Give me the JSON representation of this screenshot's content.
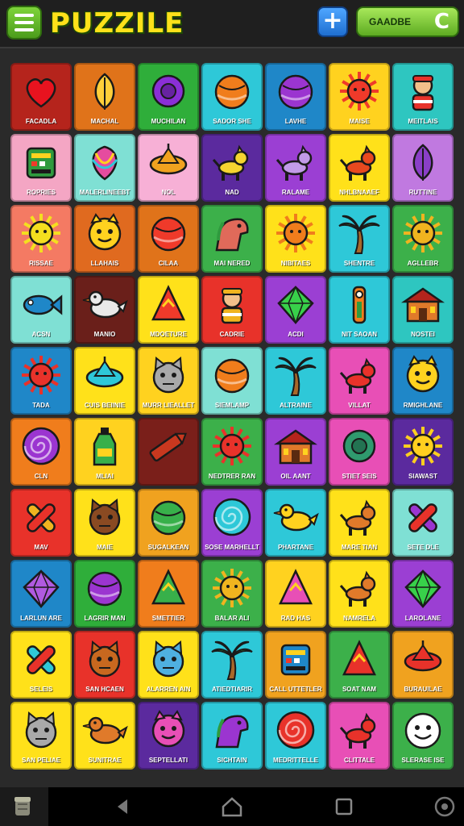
{
  "header": {
    "title": "PUZZILE",
    "game_label": "GAADBE",
    "add_symbol": "+",
    "game_icon": "C"
  },
  "colors": {
    "accent_green": "#5eac22",
    "title_yellow": "#ffe11a",
    "accent_blue": "#1f6fd1"
  },
  "tiles": [
    {
      "bg": "#b5241c",
      "icon": "heart",
      "c": "#e8131f",
      "caption": "FACADLA"
    },
    {
      "bg": "#e0731a",
      "icon": "leaf",
      "c": "#ffcf3a",
      "caption": "MACHAL"
    },
    {
      "bg": "#2fae3a",
      "icon": "ring",
      "c": "#8a2fd6",
      "caption": "MUCHILAN"
    },
    {
      "bg": "#2ec8d8",
      "icon": "ball",
      "c": "#f07d1c",
      "caption": "SADOR SHE"
    },
    {
      "bg": "#1f87c8",
      "icon": "ball",
      "c": "#9b35d0",
      "caption": "LAVHE"
    },
    {
      "bg": "#ffd21f",
      "icon": "sun",
      "c": "#ef3a2a",
      "caption": "MAISE"
    },
    {
      "bg": "#2ec6c0",
      "icon": "person",
      "c": "#e8322a",
      "caption": "MEITLAIS"
    },
    {
      "bg": "#f4a6c4",
      "icon": "square",
      "c": "#2f9a3e",
      "caption": "ROPRIES"
    },
    {
      "bg": "#7fe0d4",
      "icon": "balloon",
      "c": "#e54c9f",
      "caption": "MALERLINEEBT"
    },
    {
      "bg": "#f7b0d6",
      "icon": "spinner",
      "c": "#f0a21f",
      "caption": "NOL"
    },
    {
      "bg": "#5b2a9e",
      "icon": "dog",
      "c": "#f5d530",
      "caption": "NAD"
    },
    {
      "bg": "#9b3fd3",
      "icon": "dog",
      "c": "#c29be8",
      "caption": "RALAME"
    },
    {
      "bg": "#ffe11a",
      "icon": "dog",
      "c": "#e8491f",
      "caption": "NHLBNAAEF"
    },
    {
      "bg": "#c079e0",
      "icon": "leaf",
      "c": "#8a3fc8",
      "caption": "RUTTINE"
    },
    {
      "bg": "#f47a63",
      "icon": "sun",
      "c": "#f4df1f",
      "caption": "RISSAE"
    },
    {
      "bg": "#e06a1f",
      "icon": "face",
      "c": "#ffd21f",
      "caption": "LLAHAIS"
    },
    {
      "bg": "#e0731a",
      "icon": "ball",
      "c": "#ef3a2a",
      "caption": "CILAA"
    },
    {
      "bg": "#3cb04a",
      "icon": "horse",
      "c": "#e06a5a",
      "caption": "MAI NERED"
    },
    {
      "bg": "#ffe11a",
      "icon": "sun",
      "c": "#f07d1c",
      "caption": "NIBITAES"
    },
    {
      "bg": "#2ec8d8",
      "icon": "palm",
      "c": "#2f9a3e",
      "caption": "SHENTRE"
    },
    {
      "bg": "#3cb04a",
      "icon": "sun",
      "c": "#f0b41f",
      "caption": "AGLLEBR"
    },
    {
      "bg": "#7fe0d4",
      "icon": "fish",
      "c": "#1f87c8",
      "caption": "ACSN"
    },
    {
      "bg": "#6a1f1a",
      "icon": "bird",
      "c": "#e9e9e9",
      "caption": "MANIO"
    },
    {
      "bg": "#ffe11a",
      "icon": "cone",
      "c": "#ef3a2a",
      "caption": "MDOETURE"
    },
    {
      "bg": "#e8322a",
      "icon": "person",
      "c": "#f0b41f",
      "caption": "CADRIE"
    },
    {
      "bg": "#9b3fd3",
      "icon": "gem",
      "c": "#38d04a",
      "caption": "ACDI"
    },
    {
      "bg": "#2ec8d8",
      "icon": "key",
      "c": "#f07d1c",
      "caption": "NIT SAOAN"
    },
    {
      "bg": "#2ec6c0",
      "icon": "house",
      "c": "#b5241c",
      "caption": "NOSTEI"
    },
    {
      "bg": "#1f87c8",
      "icon": "sun",
      "c": "#e8322a",
      "caption": "TADA"
    },
    {
      "bg": "#ffe11a",
      "icon": "spinner",
      "c": "#2ec8d8",
      "caption": "CUIS BEIINIE"
    },
    {
      "bg": "#ffd21f",
      "icon": "cat",
      "c": "#a9a9a9",
      "caption": "MURR LIEALLET"
    },
    {
      "bg": "#7fe0d4",
      "icon": "ball",
      "c": "#f07d1c",
      "caption": "SIEMLAMP"
    },
    {
      "bg": "#2ec8d8",
      "icon": "palm",
      "c": "#2f9a3e",
      "caption": "ALTRAINE"
    },
    {
      "bg": "#e84fb6",
      "icon": "dog",
      "c": "#e8322a",
      "caption": "VILLAT"
    },
    {
      "bg": "#1f87c8",
      "icon": "face",
      "c": "#ffd21f",
      "caption": "RMIGHLANE"
    },
    {
      "bg": "#f07d1c",
      "icon": "spiral",
      "c": "#9b35d0",
      "caption": "CLN"
    },
    {
      "bg": "#ffd21f",
      "icon": "bottle",
      "c": "#38b04a",
      "caption": "MLIAI"
    },
    {
      "bg": "#7a1f1a",
      "icon": "crayon",
      "c": "#c8381f",
      "caption": ""
    },
    {
      "bg": "#3cb04a",
      "icon": "sun",
      "c": "#e8322a",
      "caption": "NEDTRER RAN"
    },
    {
      "bg": "#9b3fd3",
      "icon": "house",
      "c": "#b5241c",
      "caption": "OIL AANT"
    },
    {
      "bg": "#e84fb6",
      "icon": "ring",
      "c": "#2f9a6e",
      "caption": "STIET SEIS"
    },
    {
      "bg": "#5b2a9e",
      "icon": "sun",
      "c": "#ffcf1f",
      "caption": "SIAWAST"
    },
    {
      "bg": "#e8322a",
      "icon": "cross",
      "c": "#f0b41f",
      "caption": "MAV"
    },
    {
      "bg": "#ffe11a",
      "icon": "cat",
      "c": "#8a4a22",
      "caption": "MAIE"
    },
    {
      "bg": "#f0a21f",
      "icon": "ball",
      "c": "#38b04a",
      "caption": "SUGALKEAN"
    },
    {
      "bg": "#9b3fd3",
      "icon": "spiral",
      "c": "#2ec8d8",
      "caption": "SOSE MARHELLT"
    },
    {
      "bg": "#2ec8d8",
      "icon": "bird",
      "c": "#ffd21f",
      "caption": "PHARTANE"
    },
    {
      "bg": "#ffe11a",
      "icon": "dog",
      "c": "#e07a2a",
      "caption": "MARE TIAN"
    },
    {
      "bg": "#7fe0d4",
      "icon": "cross",
      "c": "#9b35d0",
      "caption": "SETE DLE"
    },
    {
      "bg": "#1f87c8",
      "icon": "gem",
      "c": "#b05ae0",
      "caption": "LARLUN ARE"
    },
    {
      "bg": "#2fae3a",
      "icon": "ball",
      "c": "#9b35d0",
      "caption": "LAGRIR MAN"
    },
    {
      "bg": "#f07d1c",
      "icon": "cone",
      "c": "#38b04a",
      "caption": "SMETTIER"
    },
    {
      "bg": "#3cb04a",
      "icon": "sun",
      "c": "#f0b41f",
      "caption": "BALAR ALI"
    },
    {
      "bg": "#ffd21f",
      "icon": "cone",
      "c": "#e84fb6",
      "caption": "RAD HAS"
    },
    {
      "bg": "#ffe11a",
      "icon": "dog",
      "c": "#e07a2a",
      "caption": "NAMRELA"
    },
    {
      "bg": "#9b3fd3",
      "icon": "gem",
      "c": "#38d04a",
      "caption": "LAROLANE"
    },
    {
      "bg": "#ffe11a",
      "icon": "cross",
      "c": "#2ec8d8",
      "caption": "SELEIS"
    },
    {
      "bg": "#e8322a",
      "icon": "cat",
      "c": "#c8681f",
      "caption": "SAN HCAEN"
    },
    {
      "bg": "#ffe11a",
      "icon": "cat",
      "c": "#4fb0e0",
      "caption": "ALARREN AIN"
    },
    {
      "bg": "#2ec8d8",
      "icon": "palm",
      "c": "#2f9a3e",
      "caption": "ATIEDTIARIR"
    },
    {
      "bg": "#f0a21f",
      "icon": "square",
      "c": "#1f87c8",
      "caption": "CALL UTTETLER"
    },
    {
      "bg": "#3cb04a",
      "icon": "cone",
      "c": "#e8322a",
      "caption": "SOAT NAM"
    },
    {
      "bg": "#f0a21f",
      "icon": "spinner",
      "c": "#e8322a",
      "caption": "BURAUILAE"
    },
    {
      "bg": "#ffe11a",
      "icon": "cat",
      "c": "#a9a9a9",
      "caption": "SAN PELIAE"
    },
    {
      "bg": "#ffe11a",
      "icon": "bird",
      "c": "#e07a2a",
      "caption": "SUNITRAE"
    },
    {
      "bg": "#5b2a9e",
      "icon": "face",
      "c": "#e84fb6",
      "caption": "SEPTELLATI"
    },
    {
      "bg": "#2ec8d8",
      "icon": "horse",
      "c": "#9b35d0",
      "caption": "SICHTAIN"
    },
    {
      "bg": "#2ec8d8",
      "icon": "spiral",
      "c": "#e8322a",
      "caption": "MEDRITTELLE"
    },
    {
      "bg": "#e84fb6",
      "icon": "dog",
      "c": "#e8322a",
      "caption": "CLITTALE"
    },
    {
      "bg": "#3cb04a",
      "icon": "smile",
      "c": "#ffffff",
      "caption": "SLERASE ISE"
    }
  ]
}
